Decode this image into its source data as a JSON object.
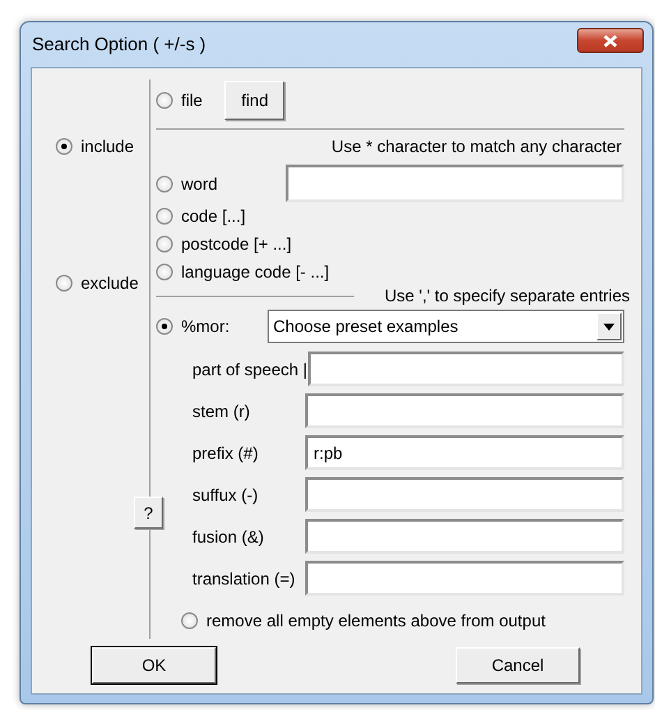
{
  "window": {
    "title": "Search Option ( +/-s )"
  },
  "mode_options": [
    {
      "label": "include",
      "selected": true
    },
    {
      "label": "exclude",
      "selected": false
    }
  ],
  "help_button": "?",
  "file_option": {
    "label": "file",
    "selected": false
  },
  "find_button": "find",
  "wildcard_hint": "Use * character to match any character",
  "word_option": {
    "label": "word",
    "selected": false
  },
  "code_options": [
    {
      "label": "code  [...]",
      "selected": false
    },
    {
      "label": "postcode [+ ...]",
      "selected": false
    },
    {
      "label": "language code [- ...]",
      "selected": false
    }
  ],
  "separator_hint": "Use ',' to specify separate entries",
  "mor_option": {
    "label": "%mor:",
    "selected": true
  },
  "preset_dropdown": {
    "value": "Choose preset examples"
  },
  "mor_fields": [
    {
      "label": "part of speech |"
    },
    {
      "label": "stem (r)"
    },
    {
      "label": "prefix (#)",
      "value": "r:pb"
    },
    {
      "label": "suffux (-)"
    },
    {
      "label": "fusion (&)"
    },
    {
      "label": "translation (=)"
    }
  ],
  "remove_empty": {
    "label": "remove all empty elements above from output",
    "selected": false
  },
  "buttons": [
    {
      "label": "OK",
      "kind": "default"
    },
    {
      "label": "Cancel",
      "kind": "normal"
    }
  ]
}
